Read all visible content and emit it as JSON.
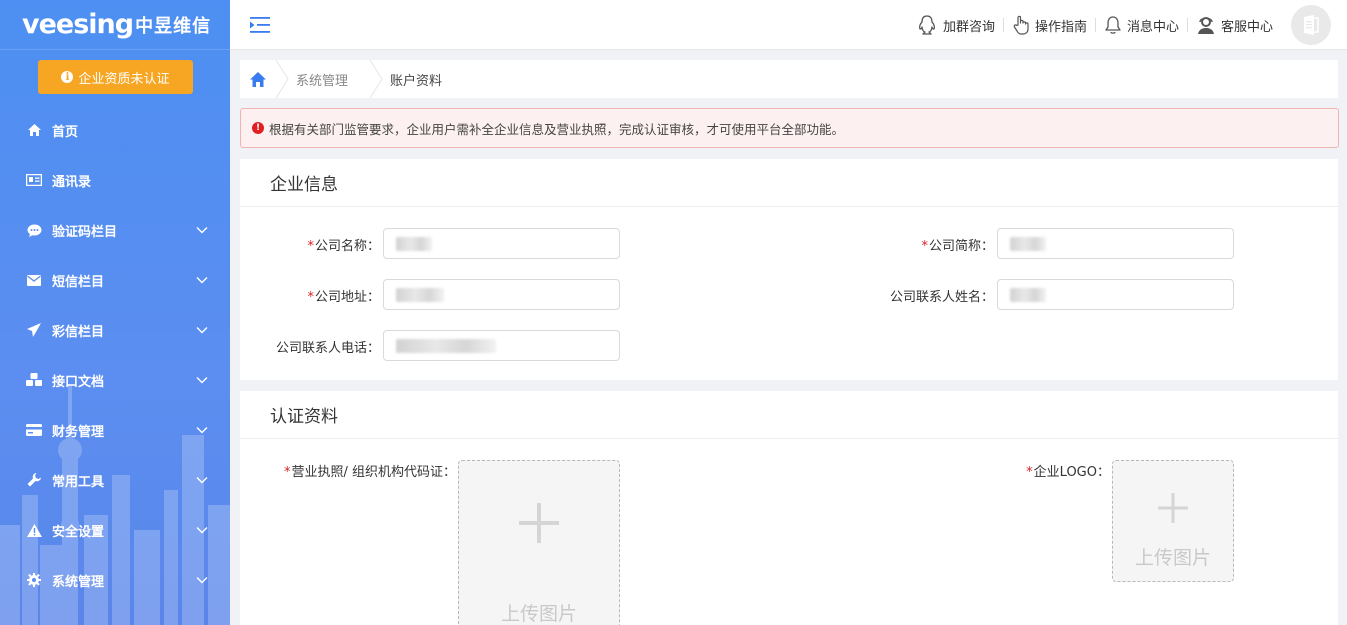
{
  "brand": {
    "logo_en": "veesing",
    "logo_cn": "中昱维信"
  },
  "sidebar": {
    "cert_button": "企业资质未认证",
    "items": [
      {
        "label": "首页",
        "icon": "home-icon",
        "expandable": false
      },
      {
        "label": "通讯录",
        "icon": "address-book-icon",
        "expandable": false
      },
      {
        "label": "验证码栏目",
        "icon": "chat-bubble-icon",
        "expandable": true
      },
      {
        "label": "短信栏目",
        "icon": "envelope-icon",
        "expandable": true
      },
      {
        "label": "彩信栏目",
        "icon": "paper-plane-icon",
        "expandable": true
      },
      {
        "label": "接口文档",
        "icon": "cubes-icon",
        "expandable": true
      },
      {
        "label": "财务管理",
        "icon": "credit-card-icon",
        "expandable": true
      },
      {
        "label": "常用工具",
        "icon": "wrench-icon",
        "expandable": true
      },
      {
        "label": "安全设置",
        "icon": "warning-icon",
        "expandable": true
      },
      {
        "label": "系统管理",
        "icon": "gear-icon",
        "expandable": true
      }
    ]
  },
  "topbar": {
    "actions": [
      {
        "label": "加群咨询",
        "icon": "qq-penguin-icon"
      },
      {
        "label": "操作指南",
        "icon": "hand-pointer-icon"
      },
      {
        "label": "消息中心",
        "icon": "bell-icon"
      },
      {
        "label": "客服中心",
        "icon": "customer-service-icon"
      }
    ]
  },
  "breadcrumb": {
    "items": [
      "系统管理",
      "账户资料"
    ]
  },
  "alert": {
    "text": "根据有关部门监管要求，企业用户需补全企业信息及营业执照，完成认证审核，才可使用平台全部功能。"
  },
  "company_info": {
    "title": "企业信息",
    "fields": {
      "name": {
        "label": "公司名称：",
        "required": true
      },
      "short_name": {
        "label": "公司简称：",
        "required": true
      },
      "address": {
        "label": "公司地址：",
        "required": true
      },
      "contact_name": {
        "label": "公司联系人姓名：",
        "required": false
      },
      "contact_phone": {
        "label": "公司联系人电话：",
        "required": false
      }
    }
  },
  "certification": {
    "title": "认证资料",
    "license": {
      "label": "营业执照/ 组织机构代码证：",
      "upload_text": "上传图片"
    },
    "logo": {
      "label": "企业LOGO：",
      "upload_text": "上传图片"
    }
  },
  "colors": {
    "sidebar": "#5b8ef0",
    "accent_orange": "#f6a623",
    "required": "#e02020",
    "alert_bg": "#fdf0f0"
  }
}
